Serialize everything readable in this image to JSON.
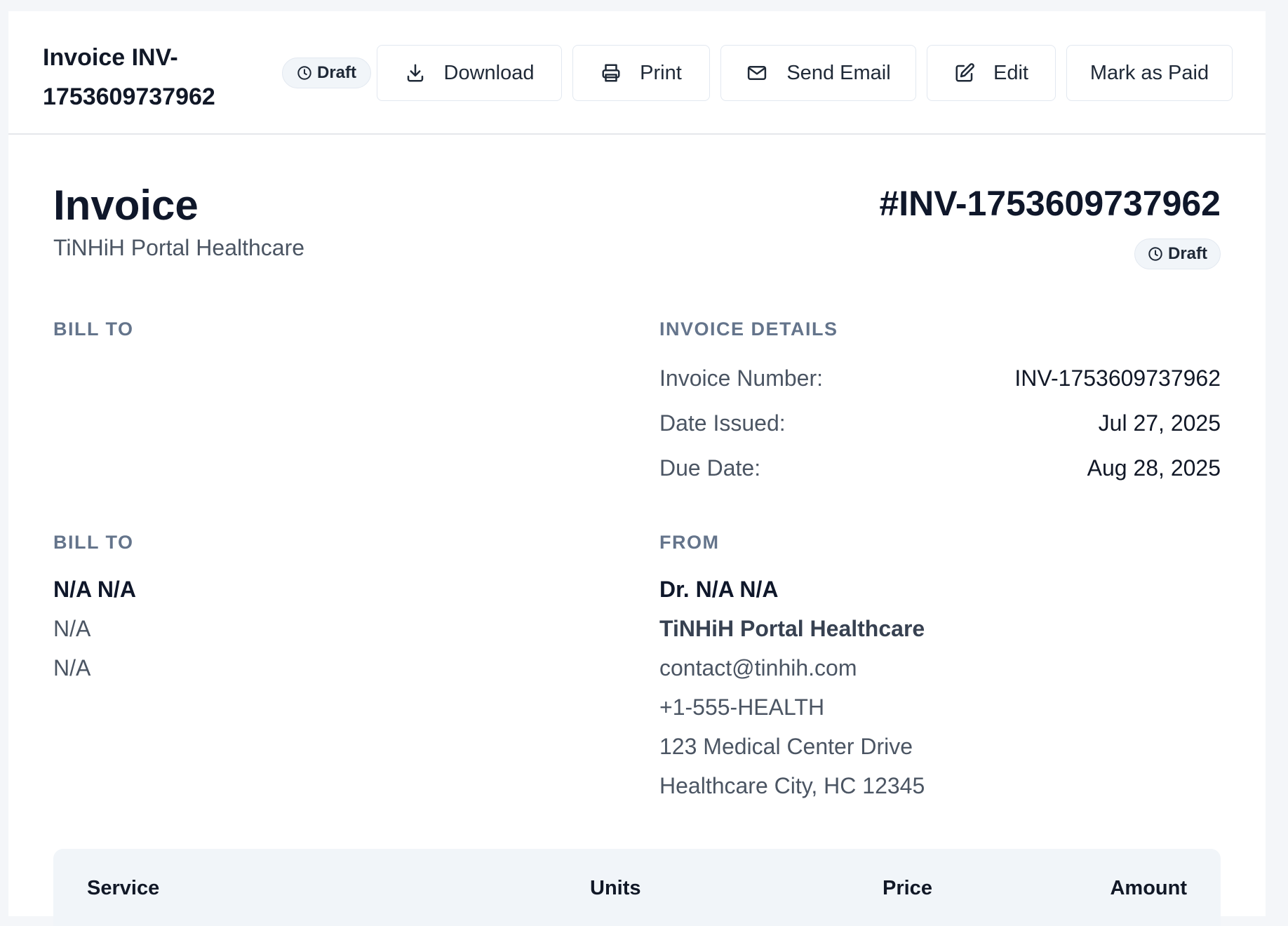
{
  "header": {
    "title": "Invoice INV-1753609737962",
    "status": "Draft",
    "buttons": {
      "download": "Download",
      "print": "Print",
      "send_email": "Send Email",
      "edit": "Edit",
      "mark_paid": "Mark as Paid"
    }
  },
  "invoice": {
    "heading": "Invoice",
    "company": "TiNHiH Portal Healthcare",
    "number_display": "#INV-1753609737962",
    "status": "Draft"
  },
  "sections": {
    "bill_to_1": "BILL TO",
    "invoice_details": "INVOICE DETAILS",
    "bill_to_2": "BILL TO",
    "from": "FROM"
  },
  "details": [
    {
      "label": "Invoice Number:",
      "value": "INV-1753609737962"
    },
    {
      "label": "Date Issued:",
      "value": "Jul 27, 2025"
    },
    {
      "label": "Due Date:",
      "value": "Aug 28, 2025"
    }
  ],
  "bill_to": {
    "name": "N/A N/A",
    "line1": "N/A",
    "line2": "N/A"
  },
  "from": {
    "doctor": "Dr. N/A N/A",
    "organization": "TiNHiH Portal Healthcare",
    "email": "contact@tinhih.com",
    "phone": "+1-555-HEALTH",
    "address1": "123 Medical Center Drive",
    "address2": "Healthcare City, HC 12345"
  },
  "table": {
    "columns": [
      "Service",
      "Units",
      "Price",
      "Amount"
    ]
  },
  "icons": {
    "clock": "clock-icon",
    "download": "download-icon",
    "print": "printer-icon",
    "email": "mail-icon",
    "edit": "edit-icon"
  }
}
